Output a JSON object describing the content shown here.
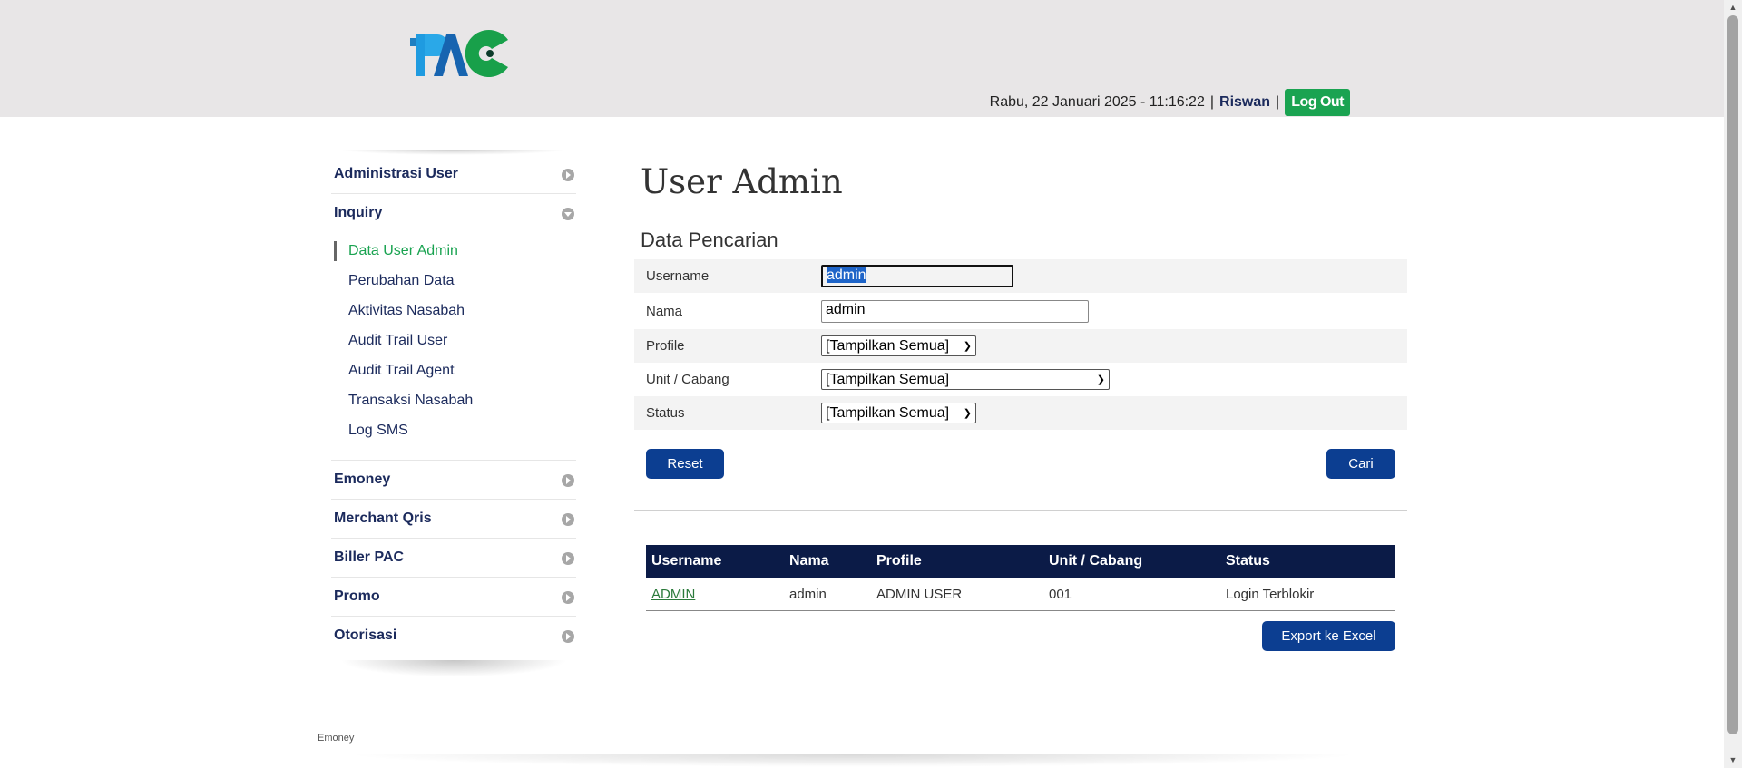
{
  "header": {
    "logo_text": "PAC",
    "datetime": "Rabu, 22 Januari 2025 - 11:16:22",
    "separator": "|",
    "username": "Riswan",
    "logout_label": "Log Out"
  },
  "sidebar": {
    "items": [
      {
        "label": "Administrasi User",
        "icon": "chevron-right-circle-icon"
      },
      {
        "label": "Inquiry",
        "icon": "chevron-down-circle-icon"
      },
      {
        "label": "Emoney",
        "icon": "chevron-right-circle-icon"
      },
      {
        "label": "Merchant Qris",
        "icon": "chevron-right-circle-icon"
      },
      {
        "label": "Biller PAC",
        "icon": "chevron-right-circle-icon"
      },
      {
        "label": "Promo",
        "icon": "chevron-right-circle-icon"
      },
      {
        "label": "Otorisasi",
        "icon": "chevron-right-circle-icon"
      }
    ],
    "inquiry_sub": [
      {
        "label": "Data User Admin",
        "active": true
      },
      {
        "label": "Perubahan Data"
      },
      {
        "label": "Aktivitas Nasabah"
      },
      {
        "label": "Audit Trail User"
      },
      {
        "label": "Audit Trail Agent"
      },
      {
        "label": "Transaksi Nasabah"
      },
      {
        "label": "Log SMS"
      }
    ]
  },
  "main": {
    "title": "User Admin",
    "search_title": "Data Pencarian",
    "form": {
      "username_label": "Username",
      "username_value": "admin",
      "nama_label": "Nama",
      "nama_value": "admin",
      "profile_label": "Profile",
      "profile_value": "[Tampilkan Semua]",
      "unit_label": "Unit / Cabang",
      "unit_value": "[Tampilkan Semua]",
      "status_label": "Status",
      "status_value": "[Tampilkan Semua]"
    },
    "reset_label": "Reset",
    "search_label": "Cari",
    "table": {
      "headers": [
        "Username",
        "Nama",
        "Profile",
        "Unit / Cabang",
        "Status"
      ],
      "rows": [
        [
          "ADMIN",
          "admin",
          "ADMIN USER",
          "001",
          "Login Terblokir"
        ]
      ]
    },
    "export_label": "Export ke Excel"
  },
  "footer": {
    "text": "Emoney"
  },
  "colors": {
    "accent_green": "#1aa351",
    "navy": "#0b1b47",
    "button_blue": "#0c3e91"
  }
}
